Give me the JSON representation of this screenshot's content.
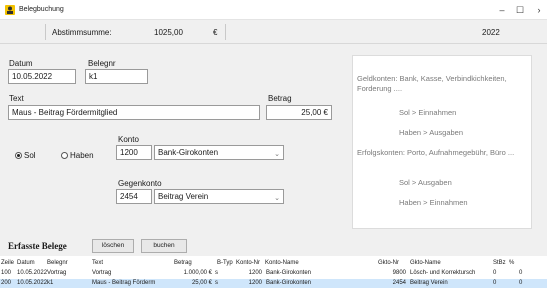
{
  "window": {
    "title": "Belegbuchung",
    "minimize": "–",
    "maximize": "☐",
    "close": "›"
  },
  "summary": {
    "label": "Abstimmsumme:",
    "value": "1025,00",
    "currency": "€",
    "year": "2022"
  },
  "form": {
    "datum_label": "Datum",
    "datum_value": "10.05.2022",
    "belegnr_label": "Belegnr",
    "belegnr_value": "k1",
    "text_label": "Text",
    "text_value": "Maus - Beitrag Fördermitglied",
    "betrag_label": "Betrag",
    "betrag_value": "25,00 €",
    "sol_label": "Sol",
    "haben_label": "Haben",
    "konto_label": "Konto",
    "konto_nr": "1200",
    "konto_name": "Bank-Girokonten",
    "gegenkonto_label": "Gegenkonto",
    "gegenkonto_nr": "2454",
    "gegenkonto_name": "Beitrag Verein"
  },
  "info": {
    "geld_text": "Geldkonten: Bank, Kasse, Verbindkichkeiten, Forderung ....",
    "geld_sol": "Sol      > Einnahmen",
    "geld_haben": "Haben > Ausgaben",
    "erfolg_text": "Erfolgskonten: Porto, Aufnahmegebühr, Büro ...",
    "erfolg_sol": "Sol      > Ausgaben",
    "erfolg_haben": "Haben > Einnahmen"
  },
  "belege": {
    "heading": "Erfasste Belege",
    "delete_label": "löschen",
    "book_label": "buchen",
    "columns": [
      "Zeile",
      "Datum",
      "Belegnr",
      "Text",
      "Betrag",
      "B-Typ",
      "Konto-Nr",
      "Konto-Name",
      "Gkto-Nr",
      "Gkto-Name",
      "StBz",
      "%"
    ],
    "rows": [
      [
        "100",
        "10.05.2022",
        "Vortrag",
        "Vortrag",
        "1.000,00 €",
        "s",
        "1200",
        "Bank-Girokonten",
        "9800",
        "Lösch- und Korrektursch",
        "0",
        "0"
      ],
      [
        "200",
        "10.05.2022",
        "k1",
        "Maus - Beitrag Förderm",
        "25,00 €",
        "s",
        "1200",
        "Bank-Girokonten",
        "2454",
        "Beitrag Verein",
        "0",
        "0"
      ]
    ]
  },
  "colors": {
    "form_bg": "#f0f0f0",
    "selected_row": "#cfe6fb",
    "info_text": "#7a7a7a"
  }
}
